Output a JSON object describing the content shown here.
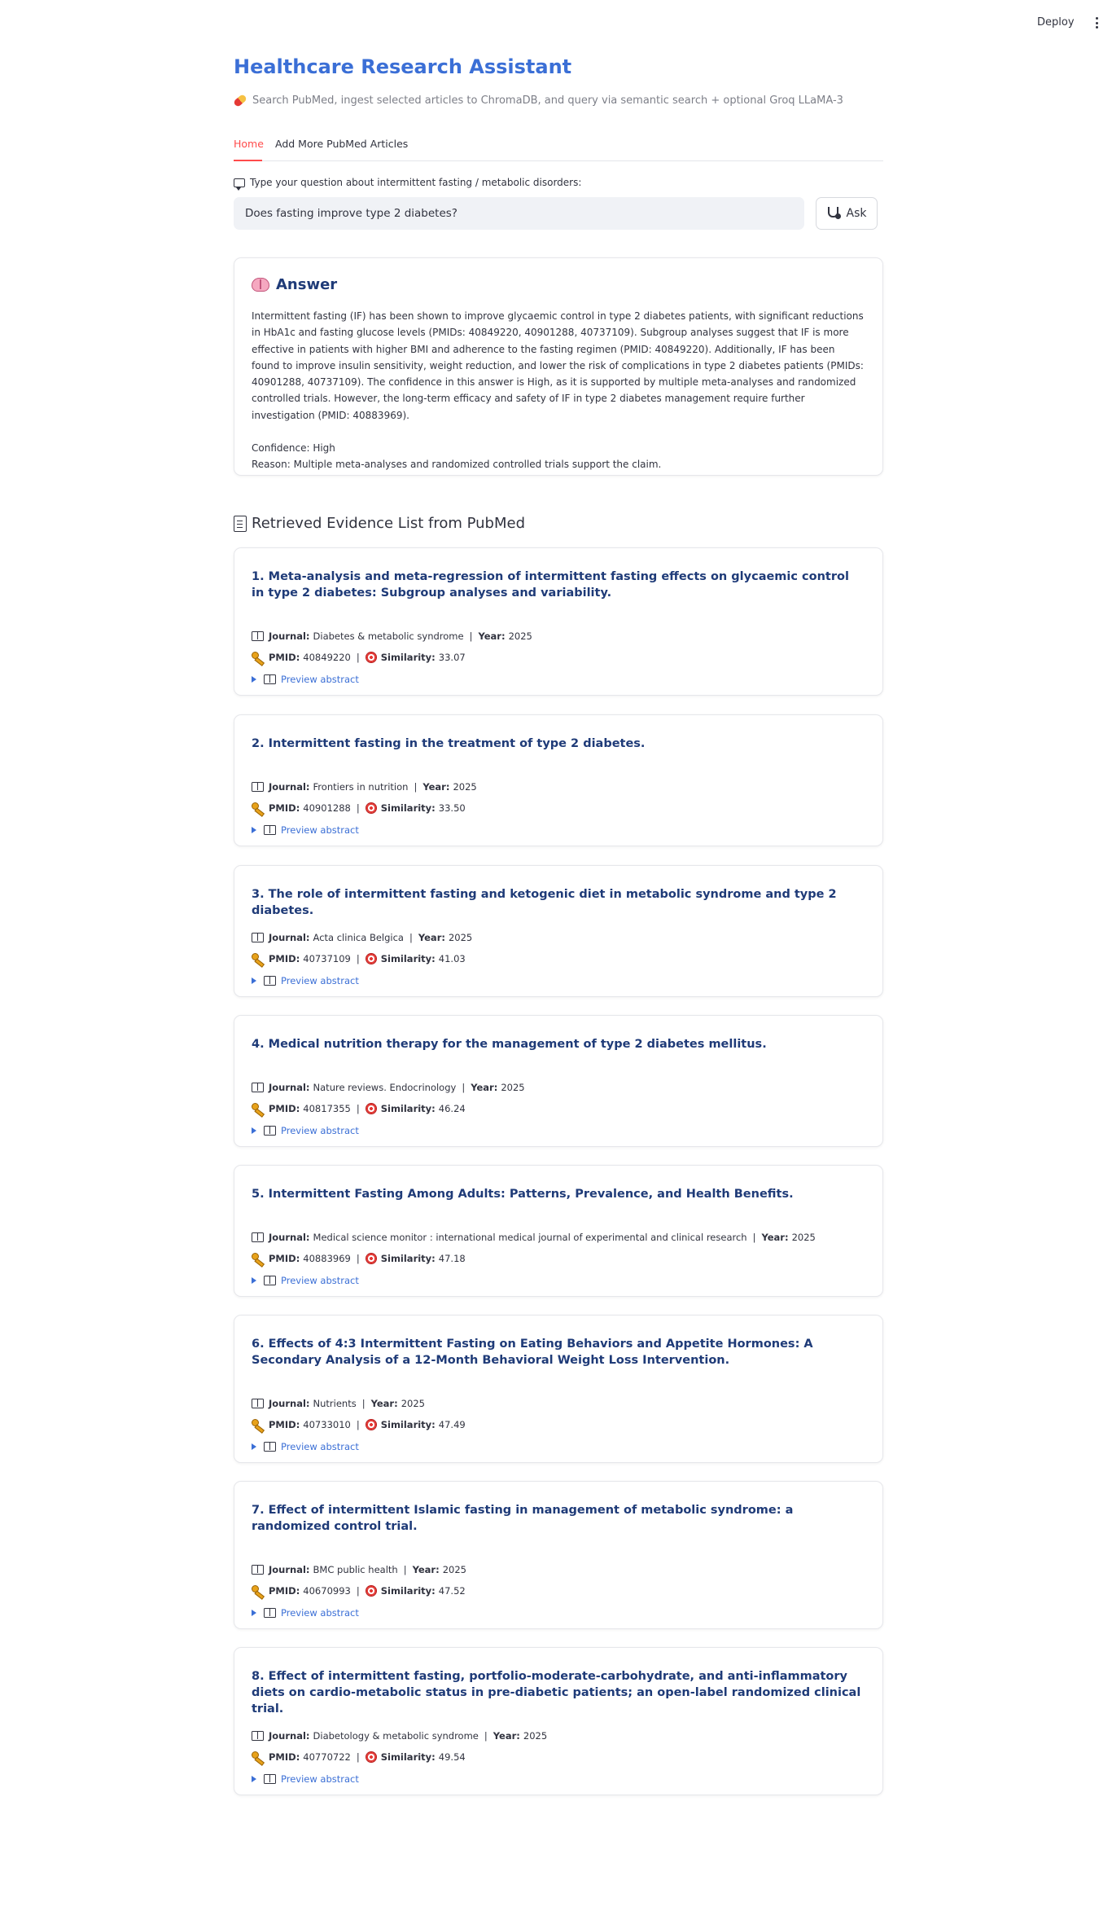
{
  "topbar": {
    "deploy_label": "Deploy",
    "menu_icon": "kebab-menu-icon"
  },
  "header": {
    "title": "Healthcare Research Assistant",
    "subtitle": "Search PubMed, ingest selected articles to ChromaDB, and query via semantic search + optional Groq LLaMA-3",
    "subtitle_icon": "pill-icon"
  },
  "tabs": [
    {
      "label": "Home",
      "active": true
    },
    {
      "label": "Add More PubMed Articles",
      "active": false
    }
  ],
  "question": {
    "label": "Type your question about intermittent fasting / metabolic disorders:",
    "value": "Does fasting improve type 2 diabetes?",
    "ask_label": "Ask"
  },
  "answer": {
    "heading": "Answer",
    "text": "Intermittent fasting (IF) has been shown to improve glycaemic control in type 2 diabetes patients, with significant reductions in HbA1c and fasting glucose levels (PMIDs: 40849220, 40901288, 40737109). Subgroup analyses suggest that IF is more effective in patients with higher BMI and adherence to the fasting regimen (PMID: 40849220). Additionally, IF has been found to improve insulin sensitivity, weight reduction, and lower the risk of complications in type 2 diabetes patients (PMIDs: 40901288, 40737109). The confidence in this answer is High, as it is supported by multiple meta-analyses and randomized controlled trials. However, the long-term efficacy and safety of IF in type 2 diabetes management require further investigation (PMID: 40883969).",
    "confidence": "Confidence: High",
    "reason": "Reason: Multiple meta-analyses and randomized controlled trials support the claim."
  },
  "evidence": {
    "heading": "Retrieved Evidence List from PubMed",
    "labels": {
      "journal": "Journal:",
      "year": "Year:",
      "pmid": "PMID:",
      "similarity": "Similarity:",
      "separator": "|",
      "preview": "Preview abstract"
    },
    "items": [
      {
        "title": "1. Meta-analysis and meta-regression of intermittent fasting effects on glycaemic control in type 2 diabetes: Subgroup analyses and variability.",
        "journal": "Diabetes & metabolic syndrome",
        "year": "2025",
        "pmid": "40849220",
        "similarity": "33.07"
      },
      {
        "title": "2. Intermittent fasting in the treatment of type 2 diabetes.",
        "journal": "Frontiers in nutrition",
        "year": "2025",
        "pmid": "40901288",
        "similarity": "33.50"
      },
      {
        "title": "3. The role of intermittent fasting and ketogenic diet in metabolic syndrome and type 2 diabetes.",
        "journal": "Acta clinica Belgica",
        "year": "2025",
        "pmid": "40737109",
        "similarity": "41.03"
      },
      {
        "title": "4. Medical nutrition therapy for the management of type 2 diabetes mellitus.",
        "journal": "Nature reviews. Endocrinology",
        "year": "2025",
        "pmid": "40817355",
        "similarity": "46.24"
      },
      {
        "title": "5. Intermittent Fasting Among Adults: Patterns, Prevalence, and Health Benefits.",
        "journal": "Medical science monitor : international medical journal of experimental and clinical research",
        "year": "2025",
        "pmid": "40883969",
        "similarity": "47.18"
      },
      {
        "title": "6. Effects of 4:3 Intermittent Fasting on Eating Behaviors and Appetite Hormones: A Secondary Analysis of a 12-Month Behavioral Weight Loss Intervention.",
        "journal": "Nutrients",
        "year": "2025",
        "pmid": "40733010",
        "similarity": "47.49"
      },
      {
        "title": "7. Effect of intermittent Islamic fasting in management of metabolic syndrome: a randomized control trial.",
        "journal": "BMC public health",
        "year": "2025",
        "pmid": "40670993",
        "similarity": "47.52"
      },
      {
        "title": "8. Effect of intermittent fasting, portfolio-moderate-carbohydrate, and anti-inflammatory diets on cardio-metabolic status in pre-diabetic patients; an open-label randomized clinical trial.",
        "journal": "Diabetology & metabolic syndrome",
        "year": "2025",
        "pmid": "40770722",
        "similarity": "49.54"
      }
    ]
  }
}
